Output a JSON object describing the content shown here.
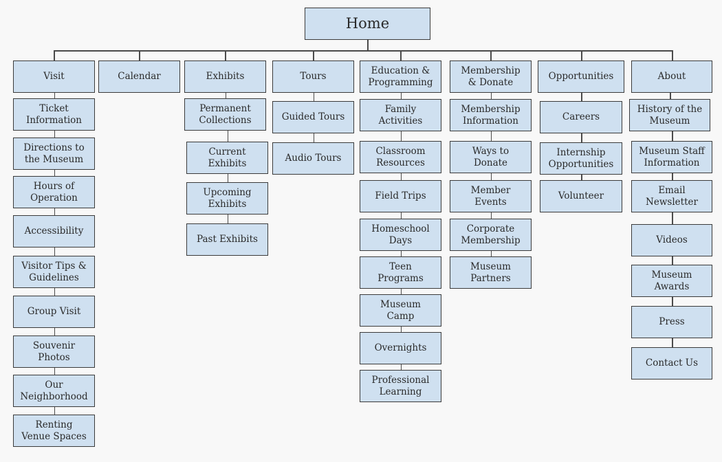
{
  "root": {
    "label": "Home"
  },
  "sections": [
    {
      "label": "Visit",
      "children": [
        "Ticket\nInformation",
        "Directions to\nthe Museum",
        "Hours of\nOperation",
        "Accessibility",
        "Visitor Tips &\nGuidelines",
        "Group Visit",
        "Souvenir\nPhotos",
        "Our\nNeighborhood",
        "Renting\nVenue Spaces"
      ]
    },
    {
      "label": "Calendar",
      "children": []
    },
    {
      "label": "Exhibits",
      "children": [
        "Permanent\nCollections",
        "Current\nExhibits",
        "Upcoming\nExhibits",
        "Past Exhibits"
      ]
    },
    {
      "label": "Tours",
      "children": [
        "Guided Tours",
        "Audio Tours"
      ]
    },
    {
      "label": "Education &\nProgramming",
      "children": [
        "Family\nActivities",
        "Classroom\nResources",
        "Field Trips",
        "Homeschool\nDays",
        "Teen\nPrograms",
        "Museum\nCamp",
        "Overnights",
        "Professional\nLearning"
      ]
    },
    {
      "label": "Membership\n& Donate",
      "children": [
        "Membership\nInformation",
        "Ways to\nDonate",
        "Member\nEvents",
        "Corporate\nMembership",
        "Museum\nPartners"
      ]
    },
    {
      "label": "Opportunities",
      "children": [
        "Careers",
        "Internship\nOpportunities",
        "Volunteer"
      ]
    },
    {
      "label": "About",
      "children": [
        "History of the\nMuseum",
        "Museum Staff\nInformation",
        "Email\nNewsletter",
        "Videos",
        "Museum\nAwards",
        "Press",
        "Contact Us"
      ]
    }
  ],
  "colors": {
    "box_fill": "#cfe0f0",
    "box_border": "#3a3a3a",
    "connector": "#4a4a4a",
    "background": "#f8f8f8"
  }
}
